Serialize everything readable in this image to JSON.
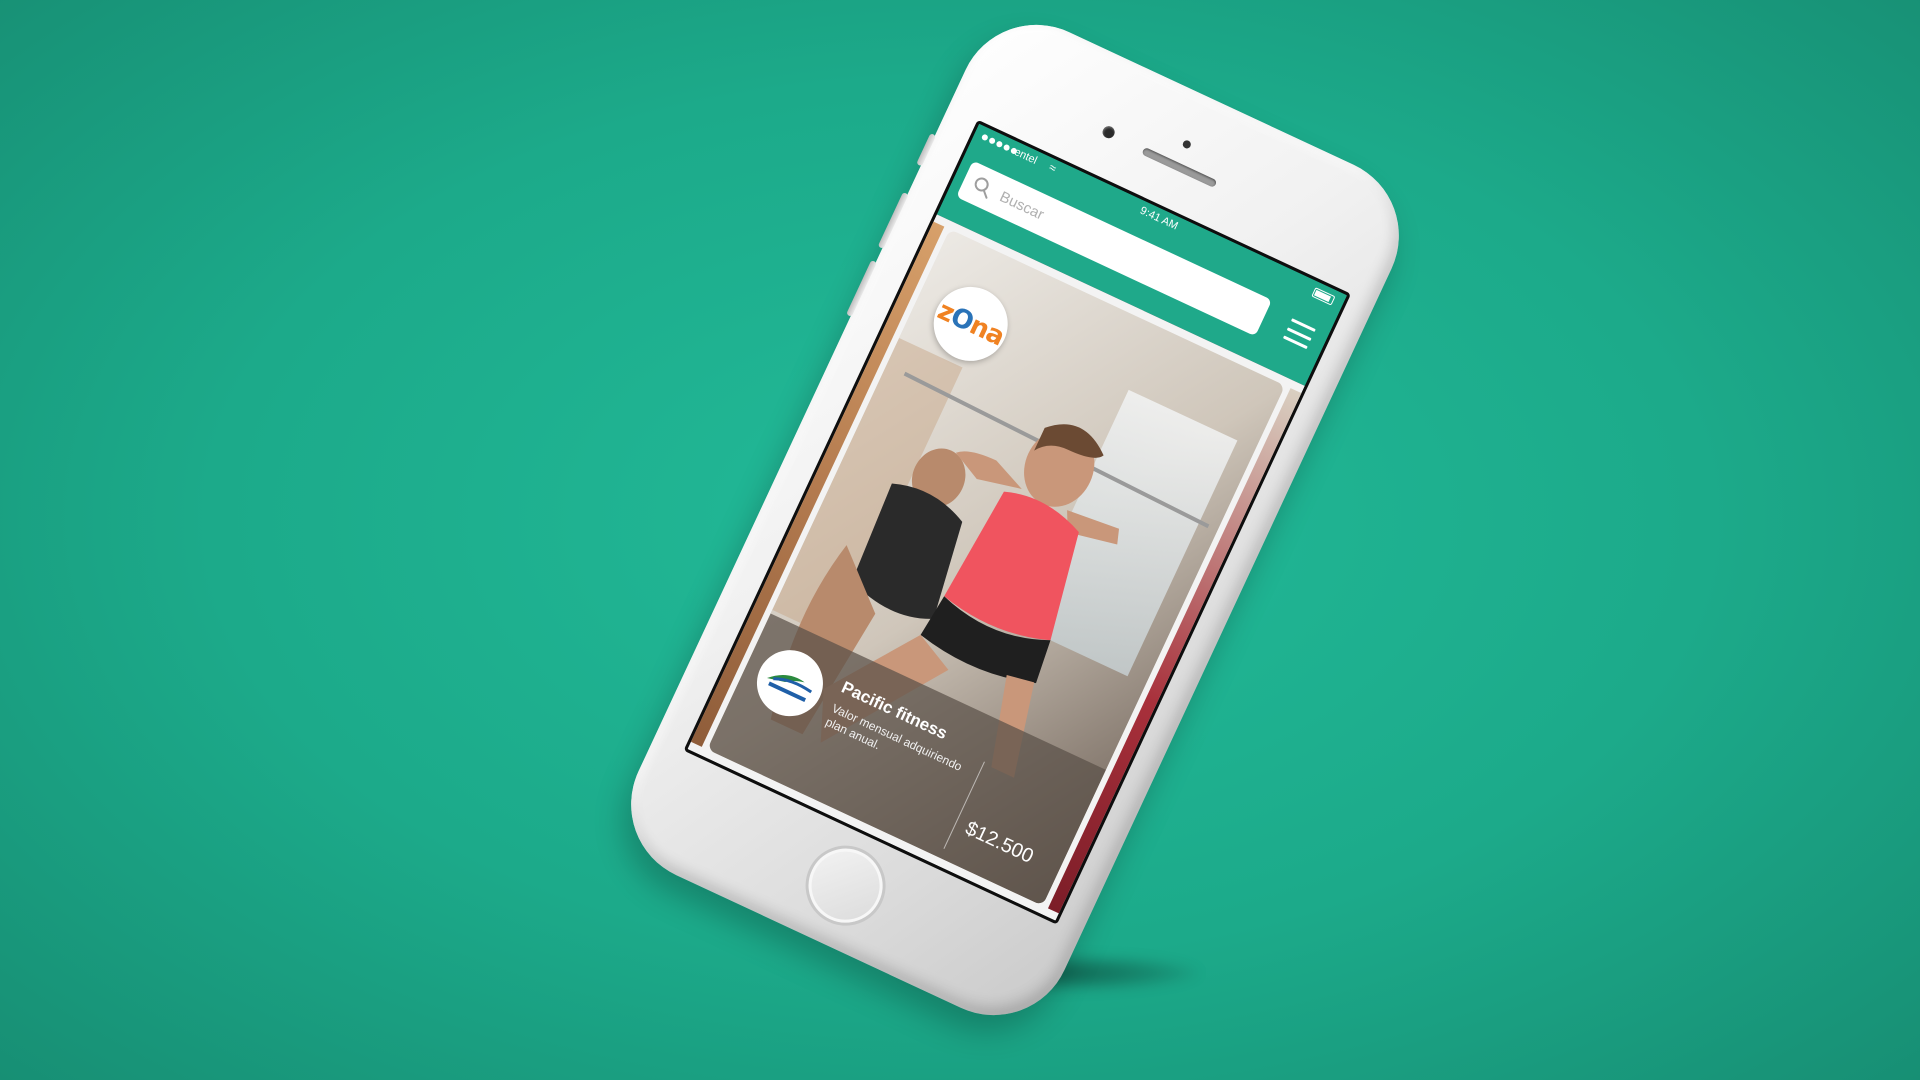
{
  "status_bar": {
    "carrier": "entel",
    "time": "9:41 AM"
  },
  "search": {
    "placeholder": "Buscar"
  },
  "brand": {
    "name": "zOna",
    "colors": {
      "primary": "#f08222",
      "secondary": "#2a73b8"
    }
  },
  "card": {
    "gym_name": "Pacific fitness",
    "description": "Valor mensual adquiriendo plan anual.",
    "price": "$12.500",
    "logo_icon": "pacific-fitness-logo"
  },
  "theme": {
    "background": "#1fb393",
    "header": "#1fa98a",
    "device": "white-iphone"
  },
  "icons": [
    "search-icon",
    "menu-icon",
    "wifi-icon",
    "battery-icon",
    "signal-icon"
  ]
}
